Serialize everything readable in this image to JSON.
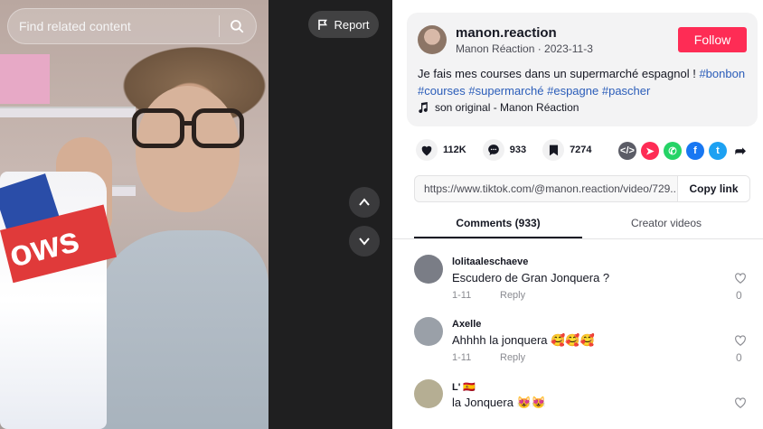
{
  "video": {
    "search_placeholder": "Find related content",
    "report_label": "Report",
    "bag_text": "ows"
  },
  "author": {
    "username": "manon.reaction",
    "nickname_date": "Manon Réaction · 2023-11-3",
    "follow_label": "Follow"
  },
  "description": {
    "text": "Je fais mes courses dans un supermarché espagnol ! ",
    "tags": [
      "#bonbon",
      "#courses",
      "#supermarché",
      "#espagne",
      "#pascher"
    ]
  },
  "music": "son original - Manon Réaction",
  "stats": {
    "likes": "112K",
    "comments": "933",
    "saves": "7274"
  },
  "share_icons": [
    {
      "name": "embed-icon",
      "color": "#5b5c66",
      "glyph": "</>"
    },
    {
      "name": "send-to-friends-icon",
      "color": "#fe2c55",
      "glyph": "➤"
    },
    {
      "name": "whatsapp-icon",
      "color": "#25d366",
      "glyph": "✆"
    },
    {
      "name": "facebook-icon",
      "color": "#1877f2",
      "glyph": "f"
    },
    {
      "name": "twitter-icon",
      "color": "#1da1f2",
      "glyph": "t"
    },
    {
      "name": "share-arrow-icon",
      "color": "#ffffff",
      "glyph": "➦"
    }
  ],
  "link": {
    "url": "https://www.tiktok.com/@manon.reaction/video/729...",
    "copy_label": "Copy link"
  },
  "tabs": [
    "Comments (933)",
    "Creator videos"
  ],
  "comments": [
    {
      "user": "lolitaaleschaeve",
      "text": "Escudero de Gran Jonquera ?",
      "date": "1-11",
      "reply": "Reply",
      "likes": "0",
      "avatar_color": "#7a7d86"
    },
    {
      "user": "Axelle",
      "text": "Ahhhh la jonquera 🥰🥰🥰",
      "date": "1-11",
      "reply": "Reply",
      "likes": "0",
      "avatar_color": "#9aa0a8"
    },
    {
      "user": "L' 🇪🇸",
      "text": "la Jonquera 😻😻",
      "date": "",
      "reply": "",
      "likes": "",
      "avatar_color": "#b5ae93"
    }
  ],
  "colors": {
    "follow": "#fe2c55",
    "hashtag": "#2b5db9"
  }
}
